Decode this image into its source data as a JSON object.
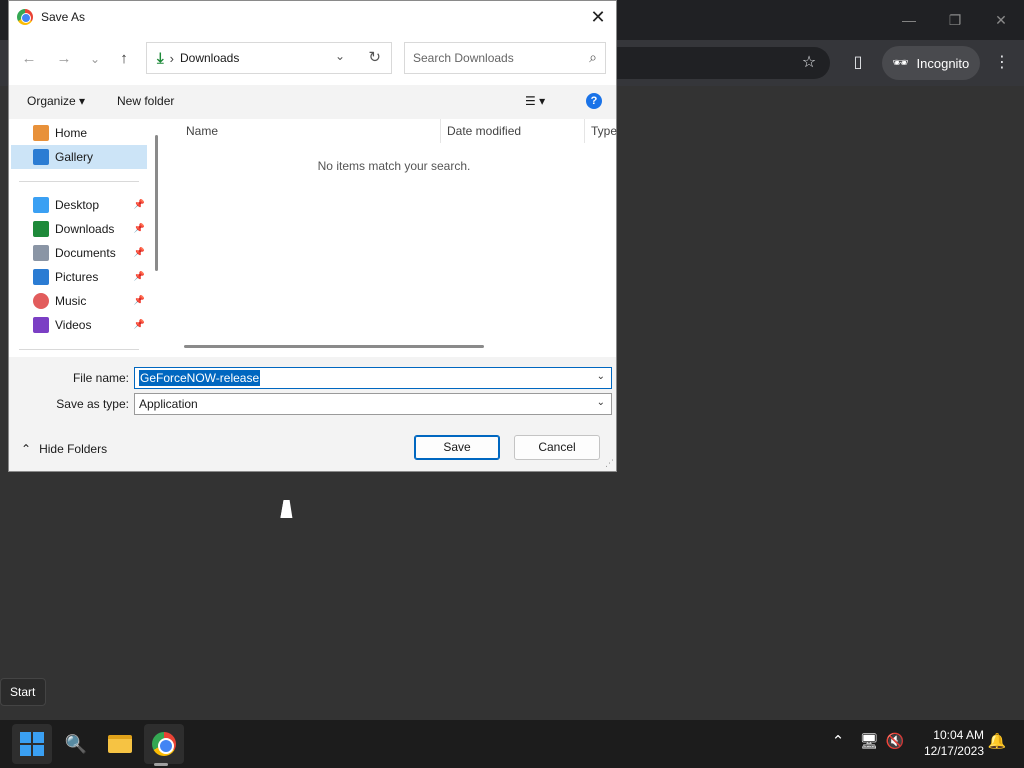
{
  "browser": {
    "incognito_label": "Incognito",
    "minimize_glyph": "—",
    "restore_glyph": "❐",
    "close_glyph": "✕",
    "star_glyph": "☆",
    "sidepanel_glyph": "▯",
    "menu_glyph": "⋮",
    "incognito_glyph": "🕶"
  },
  "dialog": {
    "title": "Save As",
    "close_glyph": "✕",
    "nav": {
      "back_glyph": "←",
      "forward_glyph": "→",
      "recent_glyph": "⌄",
      "up_glyph": "↑"
    },
    "address": {
      "icon_glyph": "⤓",
      "separator": "›",
      "location": "Downloads",
      "dropdown_glyph": "⌄",
      "refresh_glyph": "↻"
    },
    "search": {
      "placeholder": "Search Downloads",
      "glyph": "⌕"
    },
    "commands": {
      "organize": "Organize ▾",
      "new_folder": "New folder",
      "view_glyph": "☰ ▾",
      "help_glyph": "?"
    },
    "sidebar": {
      "quick": [
        {
          "label": "Home",
          "icon": "home-icon",
          "color": "#e8913a"
        },
        {
          "label": "Gallery",
          "icon": "gallery-icon",
          "color": "#2b7cd3"
        }
      ],
      "pinned": [
        {
          "label": "Desktop",
          "icon": "desktop-icon",
          "color": "#3aa0f3"
        },
        {
          "label": "Downloads",
          "icon": "downloads-icon",
          "color": "#1e8a3a"
        },
        {
          "label": "Documents",
          "icon": "documents-icon",
          "color": "#8a95a5"
        },
        {
          "label": "Pictures",
          "icon": "pictures-icon",
          "color": "#2b7cd3"
        },
        {
          "label": "Music",
          "icon": "music-icon",
          "color": "#e25c5c"
        },
        {
          "label": "Videos",
          "icon": "videos-icon",
          "color": "#7b3fc4"
        }
      ],
      "pin_glyph": "📌"
    },
    "columns": {
      "name": "Name",
      "date_modified": "Date modified",
      "type": "Type"
    },
    "empty_message": "No items match your search.",
    "file_name_label": "File name:",
    "file_name_value": "GeForceNOW-release",
    "save_type_label": "Save as type:",
    "save_type_value": "Application",
    "field_caret": "⌄",
    "hide_folders_glyph": "⌃",
    "hide_folders": "Hide Folders",
    "save_button": "Save",
    "cancel_button": "Cancel",
    "grip_glyph": "⋰"
  },
  "tooltip": "Start",
  "taskbar": {
    "search_glyph": "🔍",
    "tray_chevron": "⌃",
    "network_glyph": "🖥",
    "volume_glyph": "🔇",
    "bell_glyph": "🔔",
    "time": "10:04 AM",
    "date": "12/17/2023"
  }
}
